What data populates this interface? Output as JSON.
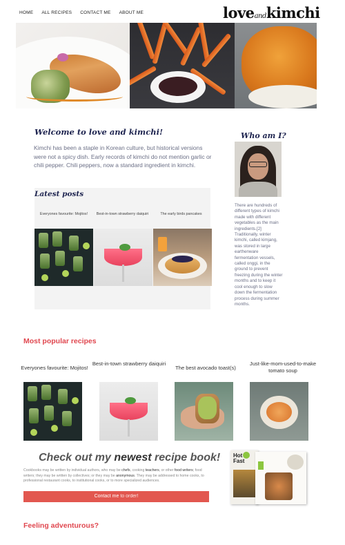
{
  "nav": {
    "items": [
      "HOME",
      "ALL RECIPES",
      "CONTACT ME",
      "ABOUT ME"
    ]
  },
  "logo": {
    "love": "love",
    "and": "and",
    "kimchi": "kimchi"
  },
  "welcome": {
    "title": "Welcome to love and kimchi!",
    "text": "Kimchi has been a staple in Korean culture, but historical versions were not a spicy dish. Early records of kimchi do not mention garlic or chili pepper. Chili peppers, now a standard ingredient in kimchi."
  },
  "about": {
    "title": "Who am I?",
    "text": "There are hundreds of different types of kimchi made with different vegetables as the main ingredients.[2] Traditionally, winter kimchi, called kimjang, was stored in large earthenware fermentation vessels, called onggi, in the ground to prevent freezing during the winter months and to keep it cool enough to slow down the fermentation process during summer months."
  },
  "latest": {
    "title": "Latest posts",
    "posts": [
      "Everyones favourite: Mojitos!",
      "Best-in-town strawberry daiquiri",
      "The early birds pancakes"
    ]
  },
  "popular": {
    "title": "Most popular recipes",
    "recipes": [
      "Everyones favourite: Mojitos!",
      "Best-in-town strawberry daiquiri",
      "The best avocado toast(s)",
      "Just-like-mom-used-to-make tomato soup"
    ]
  },
  "book": {
    "title_pre": "Check out my ",
    "title_bold": "newest",
    "title_post": " recipe book!",
    "text_1": "Cookbooks may be written by individual authors, who may be ",
    "chefs": "chefs",
    "text_2": ", cooking ",
    "teachers": "teachers",
    "text_3": ", or other ",
    "food_writers": "food writers",
    "text_4": "; food writers; they may be written by collectives; or they may be ",
    "anonymous": "anonymous",
    "text_5": ". They may be addressed to home cooks, to professional restaurant cooks, to institutional cooks, or to more specialized audiences.",
    "button_bold": "Contact me",
    "button_light": " to order!",
    "cover_title": "Hot & Fast"
  },
  "adventurous": {
    "title": "Feeling adventurous?"
  },
  "colors": {
    "accent": "#e0474f",
    "heading": "#1f2550",
    "button": "#e2574f"
  }
}
